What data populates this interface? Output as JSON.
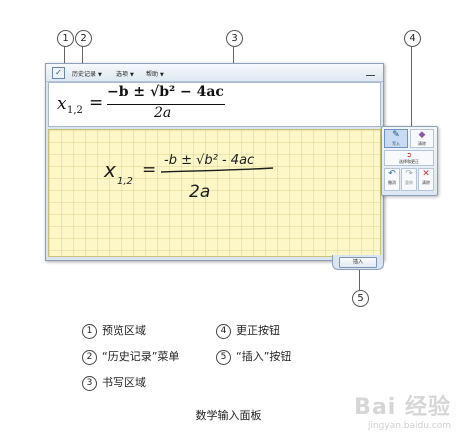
{
  "callouts": [
    "1",
    "2",
    "3",
    "4",
    "5"
  ],
  "menubar": {
    "history_label": "历史记录",
    "options_label": "选项",
    "help_label": "帮助"
  },
  "preview": {
    "lhs": "x",
    "lhs_subscript": "1,2",
    "equals": "=",
    "numerator": "−b ± √b² − 4ac",
    "denominator": "2a"
  },
  "handwriting": {
    "lhs": "x",
    "lhs_subscript": "1,2",
    "equals": "=",
    "numerator": "-b ± √b² - 4ac",
    "denominator": "2a"
  },
  "correction_panel": {
    "write_label": "写入",
    "erase_label": "清除",
    "select_correct_label": "选择和更正",
    "undo_label": "撤消",
    "redo_label": "重做",
    "clear_label": "清除"
  },
  "insert_label": "插入",
  "legend": [
    {
      "num": "1",
      "text": "预览区域"
    },
    {
      "num": "2",
      "text": "“历史记录”菜单"
    },
    {
      "num": "3",
      "text": "书写区域"
    },
    {
      "num": "4",
      "text": "更正按钮"
    },
    {
      "num": "5",
      "text": "“插入”按钮"
    }
  ],
  "caption": "数学输入面板",
  "watermark": "Bai 经验",
  "watermark_url": "jingyan.baidu.com",
  "colors": {
    "writing_area": "#fdf7c8",
    "window_frame": "#dbe5f1",
    "active_button": "#c7dcf3"
  }
}
